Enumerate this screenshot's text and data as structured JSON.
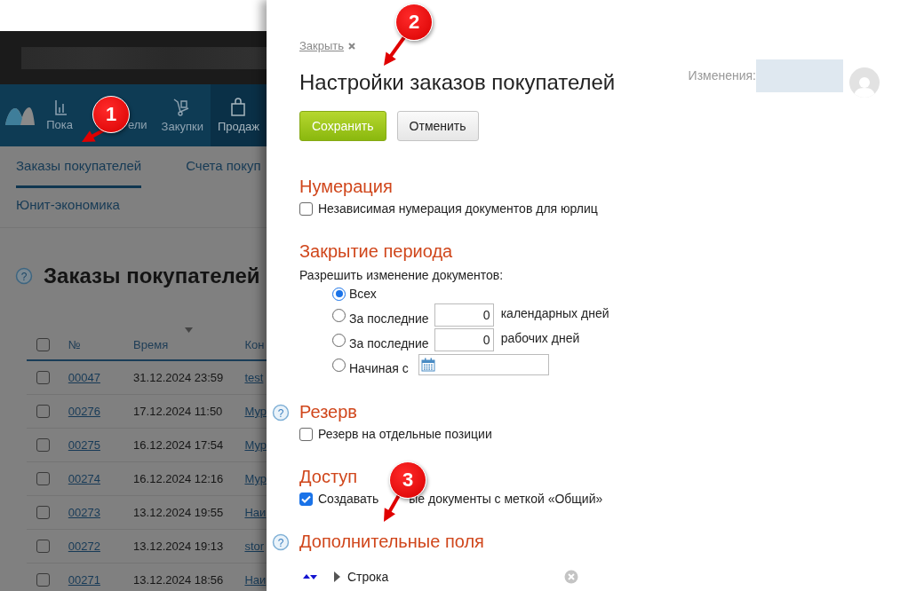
{
  "background_app": {
    "nav_items": [
      {
        "label": "Пока",
        "label_rest": "ели",
        "selected": false
      },
      {
        "label": "Закупки",
        "selected": false
      },
      {
        "label": "Продаж",
        "selected": true
      }
    ],
    "subnav_tabs": [
      {
        "label": "Заказы покупателей",
        "selected": true
      },
      {
        "label": "Счета покуп",
        "selected": false
      },
      {
        "label": "Юнит-экономика",
        "selected": false
      }
    ],
    "title_help": "?",
    "page_title": "Заказы покупателей",
    "table": {
      "select_all_checked": false,
      "columns": [
        "№",
        "Время",
        "Кон"
      ],
      "rows": [
        {
          "number": "00047",
          "time": "31.12.2024 23:59",
          "counterparty": "test",
          "checked": false
        },
        {
          "number": "00276",
          "time": "17.12.2024 11:50",
          "counterparty": "Мур",
          "checked": false
        },
        {
          "number": "00275",
          "time": "16.12.2024 17:54",
          "counterparty": "Мур",
          "checked": false
        },
        {
          "number": "00274",
          "time": "16.12.2024 12:16",
          "counterparty": "Мур",
          "checked": false
        },
        {
          "number": "00273",
          "time": "13.12.2024 19:55",
          "counterparty": "Наи",
          "checked": false
        },
        {
          "number": "00272",
          "time": "13.12.2024 19:13",
          "counterparty": "stor",
          "checked": false
        },
        {
          "number": "00271",
          "time": "13.12.2024 18:56",
          "counterparty": "Наи",
          "checked": false
        }
      ]
    }
  },
  "panel": {
    "close_link": "Закрыть",
    "title": "Настройки заказов покупателей",
    "changes_label": "Изменения:",
    "buttons": [
      {
        "label": "Сохранить",
        "kind": "primary"
      },
      {
        "label": "Отменить",
        "kind": "secondary"
      }
    ],
    "sections": [
      {
        "kind": "checkboxes",
        "title": "Нумерация",
        "options": [
          {
            "label": "Независимая нумерация документов для юрлиц",
            "checked": false
          }
        ]
      },
      {
        "kind": "period",
        "title": "Закрытие периода",
        "prompt": "Разрешить изменение документов:",
        "options": [
          {
            "kind": "plain",
            "label": "Всех",
            "selected": true
          },
          {
            "kind": "number",
            "label": "За последние",
            "value": "0",
            "suffix": "календарных дней",
            "selected": false
          },
          {
            "kind": "number",
            "label": "За последние",
            "value": "0",
            "suffix": "рабочих дней",
            "selected": false
          },
          {
            "kind": "date",
            "label": "Начиная с",
            "selected": false
          }
        ]
      },
      {
        "kind": "checkboxes",
        "title": "Резерв",
        "help": "?",
        "options": [
          {
            "label": "Резерв на отдельные позиции",
            "checked": false
          }
        ]
      },
      {
        "kind": "checkboxes",
        "title": "Доступ",
        "options": [
          {
            "label": "Создавать",
            "label_rest": "ые документы с меткой «Общий»",
            "checked": true
          }
        ]
      },
      {
        "kind": "fields",
        "title": "Дополнительные поля",
        "help": "?",
        "fields": [
          {
            "label": "Строка",
            "expanded": false
          }
        ]
      }
    ]
  },
  "annotations": [
    {
      "label": "1"
    },
    {
      "label": "2"
    },
    {
      "label": "3"
    }
  ]
}
